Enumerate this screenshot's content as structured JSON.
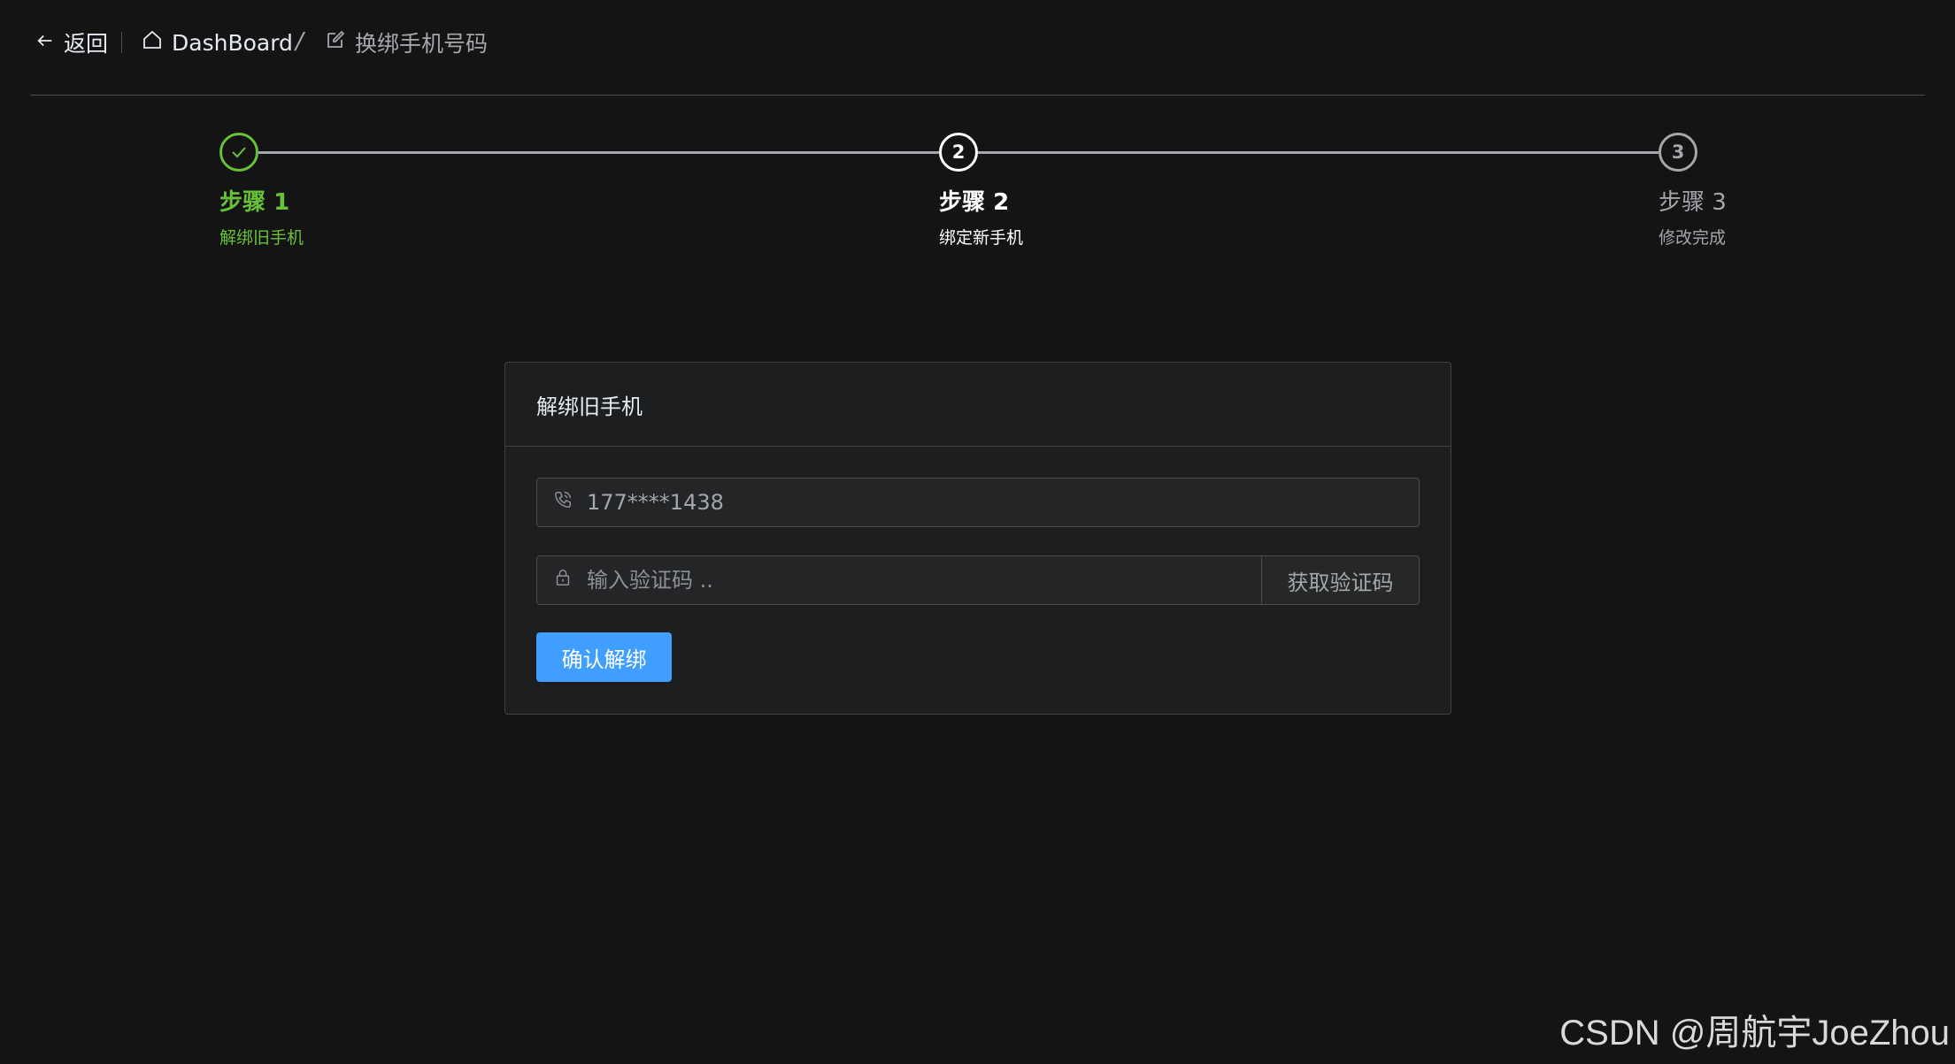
{
  "header": {
    "back_label": "返回",
    "breadcrumb": [
      {
        "label": "DashBoard",
        "icon": "home-icon"
      },
      {
        "label": "换绑手机号码",
        "icon": "edit-icon"
      }
    ],
    "separator": "/"
  },
  "steps": [
    {
      "number": "1",
      "title": "步骤",
      "desc": "解绑旧手机",
      "status": "finished",
      "color": "#67c23a"
    },
    {
      "number": "2",
      "title": "步骤",
      "desc": "绑定新手机",
      "status": "process",
      "color": "#ffffff"
    },
    {
      "number": "3",
      "title": "步骤",
      "desc": "修改完成",
      "status": "wait",
      "color": "#a3a6ad"
    }
  ],
  "card": {
    "title": "解绑旧手机",
    "phone_value": "177****1438",
    "code_placeholder": "输入验证码 ..",
    "get_code_label": "获取验证码",
    "confirm_label": "确认解绑"
  },
  "watermark": "CSDN @周航宇JoeZhou",
  "colors": {
    "primary": "#409eff",
    "success": "#67c23a",
    "background": "#141414"
  }
}
